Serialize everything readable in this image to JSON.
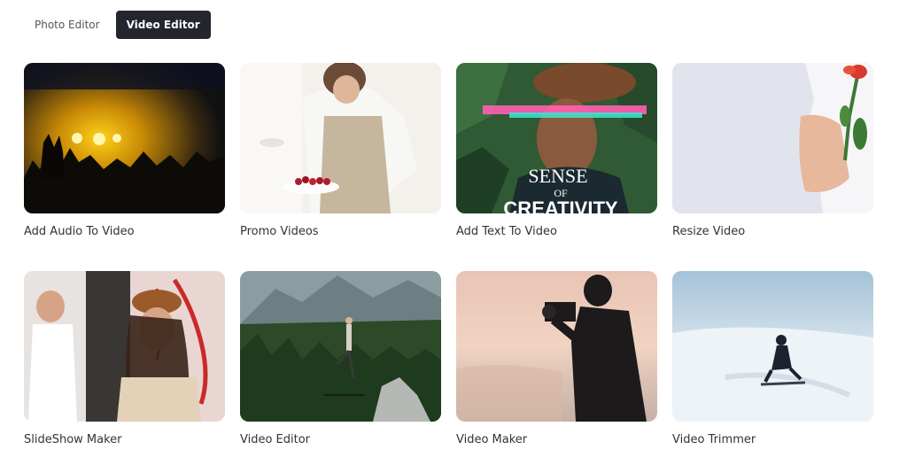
{
  "tabs": [
    {
      "label": "Photo Editor",
      "active": false
    },
    {
      "label": "Video Editor",
      "active": true
    }
  ],
  "cards": [
    {
      "label": "Add Audio To Video",
      "image": "concert-crowd-image"
    },
    {
      "label": "Promo Videos",
      "image": "woman-baking-image"
    },
    {
      "label": "Add Text To Video",
      "image": "man-with-hat-text-image",
      "overlay_text": [
        "SENSE",
        "OF",
        "CREATIVITY"
      ]
    },
    {
      "label": "Resize Video",
      "image": "hand-holding-flower-image"
    },
    {
      "label": "SlideShow Maker",
      "image": "woman-with-beret-image"
    },
    {
      "label": "Video Editor",
      "image": "mountain-forest-yoga-image"
    },
    {
      "label": "Video Maker",
      "image": "photographer-silhouette-image"
    },
    {
      "label": "Video Trimmer",
      "image": "snowboarder-image"
    }
  ]
}
